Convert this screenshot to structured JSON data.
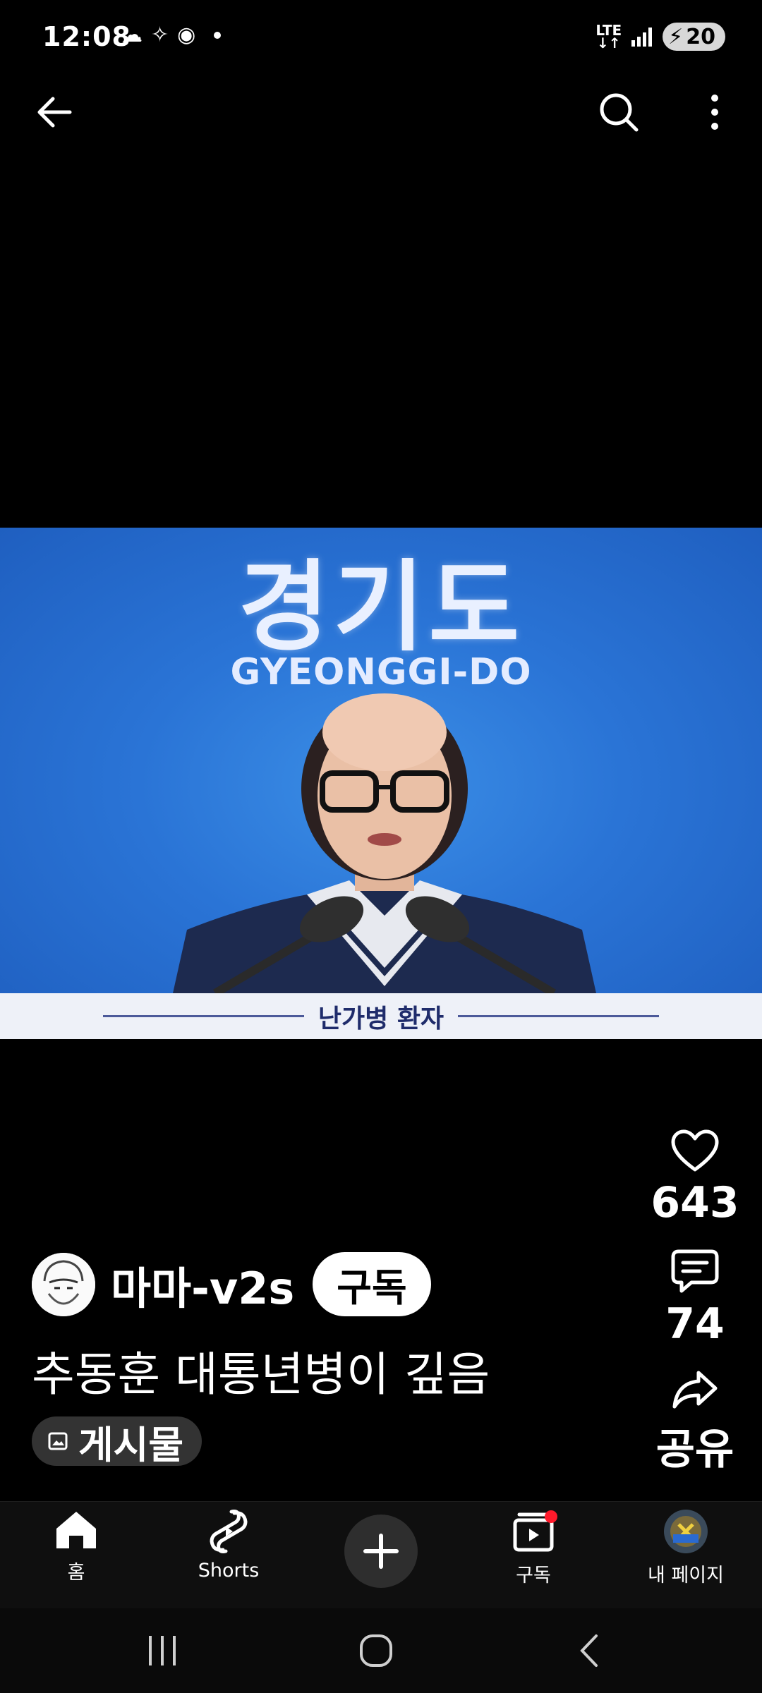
{
  "status_bar": {
    "time": "12:08",
    "network": "LTE",
    "battery": "20"
  },
  "video": {
    "title_ko": "경기도",
    "title_en": "GYEONGGI-DO",
    "caption": "난가병 환자"
  },
  "actions": {
    "like_count": "643",
    "comment_count": "74",
    "share_label": "공유"
  },
  "channel": {
    "name": "마마-v2s",
    "subscribe_label": "구독"
  },
  "description": "추동훈 대통년병이 깊음",
  "post_chip_label": "게시물",
  "bottom_nav": {
    "home": "홈",
    "shorts": "Shorts",
    "subscriptions": "구독",
    "my_page": "내 페이지"
  },
  "colors": {
    "background": "#000000",
    "video_blue": "#2a74d6",
    "caption_text": "#1f2c6b",
    "notification": "#ff1a2b"
  }
}
